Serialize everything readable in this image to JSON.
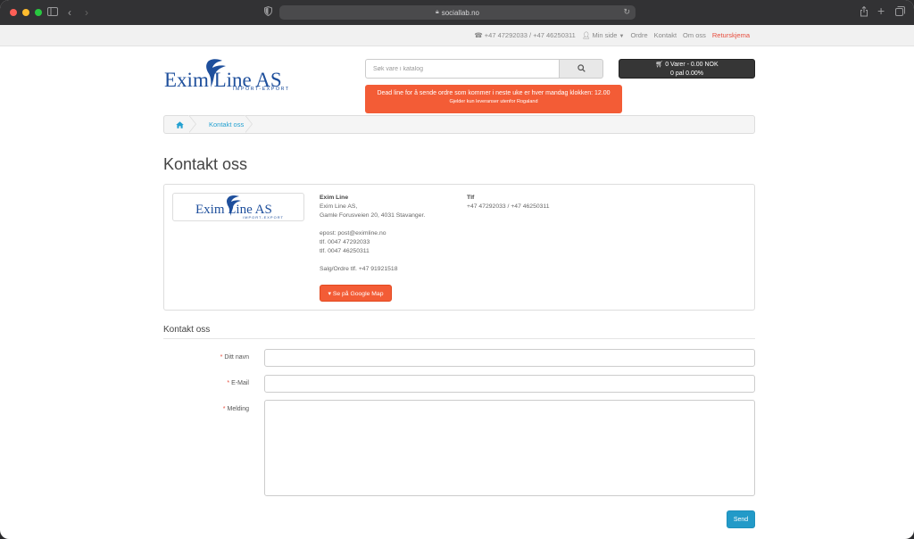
{
  "browser": {
    "url": "sociallab.no"
  },
  "topbar": {
    "phones": "+47 47292033 / +47 46250311",
    "my_page": "Min side",
    "links": [
      "Ordre",
      "Kontakt",
      "Om oss"
    ],
    "returskjema": "Returskjema"
  },
  "logo": {
    "name": "Exim Line AS",
    "tagline": "IMPORT-EXPORT"
  },
  "search": {
    "placeholder": "Søk vare i katalog"
  },
  "cart": {
    "line1": "0 Varer - 0.00 NOK",
    "line2": "0 pal 0.00%"
  },
  "notice": {
    "line1": "Dead line for å sende ordre som kommer i neste uke er hver mandag klokken: 12.00",
    "line2": "Gjelder kun leveranser utenfor Rogaland"
  },
  "breadcrumb": {
    "current": "Kontakt oss"
  },
  "page_title": "Kontakt oss",
  "store": {
    "name": "Exim Line",
    "address_line1": "Exim Line AS,",
    "address_line2": "Gamle Forusveien 20, 4031 Stavanger.",
    "email": "epost: post@eximline.no",
    "tel1": "tlf. 0047 47292033",
    "tel2": "tlf. 0047 46250311",
    "sales": "Salg/Ordre tlf. +47 91921518",
    "map_button": "Se på Google Map",
    "tlf_heading": "Tlf",
    "tlf_value": "+47 47292033 / +47 46250311"
  },
  "form": {
    "legend": "Kontakt oss",
    "name_label": "Ditt navn",
    "email_label": "E-Mail",
    "message_label": "Melding",
    "send": "Send"
  },
  "colors": {
    "accent_orange": "#f35c36",
    "link_blue": "#23a1d1",
    "button_blue": "#229ac8",
    "logo_blue": "#1e4f9c"
  }
}
